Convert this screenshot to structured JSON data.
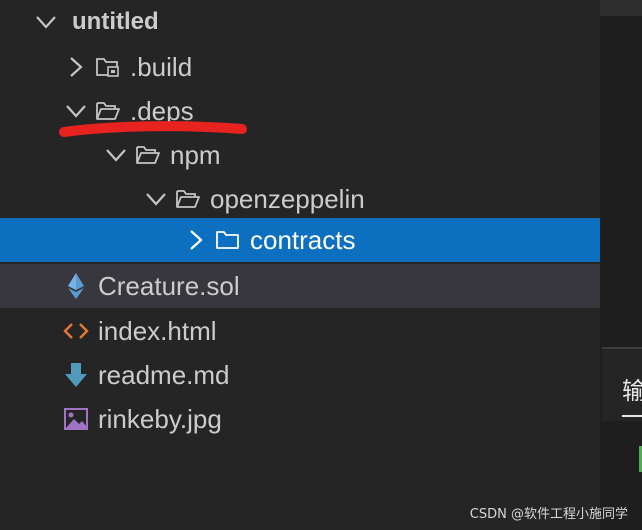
{
  "explorer": {
    "root": {
      "label": "untitled",
      "expanded": true
    },
    "items": [
      {
        "label": ".build",
        "icon": "folder-locked-icon",
        "chevron": "chevron-right-icon"
      },
      {
        "label": ".deps",
        "icon": "folder-open-icon",
        "chevron": "chevron-down-icon"
      },
      {
        "label": "npm",
        "icon": "folder-open-icon",
        "chevron": "chevron-down-icon"
      },
      {
        "label": "openzeppelin",
        "icon": "folder-open-icon",
        "chevron": "chevron-down-icon"
      },
      {
        "label": "contracts",
        "icon": "folder-icon",
        "chevron": "chevron-right-icon",
        "selected": true
      },
      {
        "label": "Creature.sol",
        "icon": "ethereum-icon",
        "hover": true
      },
      {
        "label": "index.html",
        "icon": "html-code-icon"
      },
      {
        "label": "readme.md",
        "icon": "markdown-download-icon"
      },
      {
        "label": "rinkeby.jpg",
        "icon": "image-icon"
      }
    ]
  },
  "panel": {
    "tab_label": "输"
  },
  "watermark": "CSDN @软件工程小施同学",
  "colors": {
    "sidebar_bg": "#252526",
    "editor_bg": "#1e1e1e",
    "selection": "#0c6fbf",
    "hover_row": "#37373d",
    "annotation": "#e8231f",
    "solidity_icon": "#5a9bd4",
    "html_icon": "#e37933",
    "markdown_icon": "#519aba",
    "image_icon": "#a074c4"
  }
}
